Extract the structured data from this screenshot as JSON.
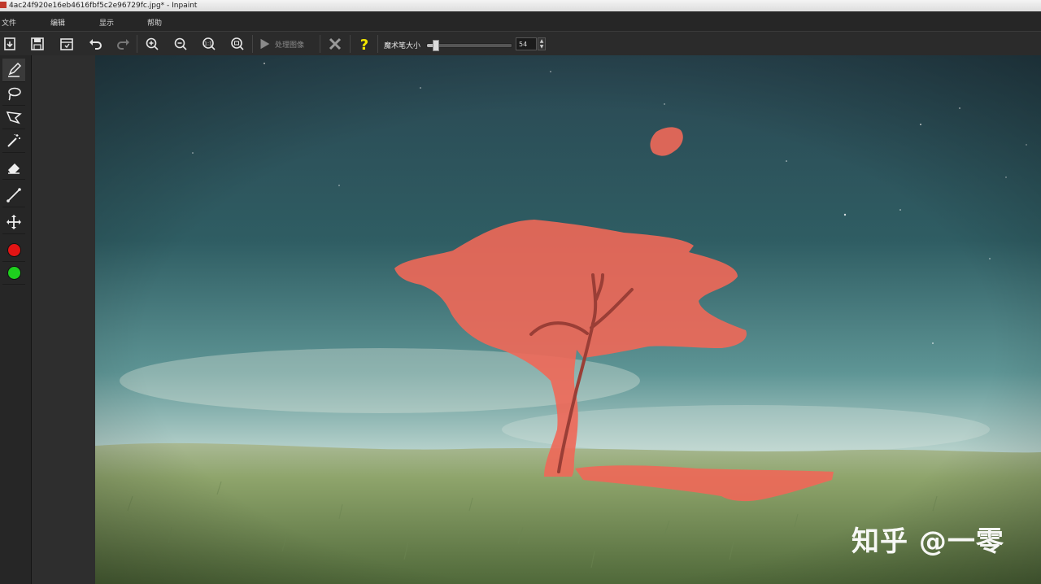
{
  "window": {
    "title": "4ac24f920e16eb4616fbf5c2e96729fc.jpg* - Inpaint"
  },
  "menu": {
    "items": [
      "文件",
      "编辑",
      "显示",
      "帮助"
    ]
  },
  "toolbar": {
    "process_label": "处理图像",
    "brush_size_label": "魔术笔大小",
    "brush_size_value": "54",
    "brush_size_fraction": 0.1
  },
  "tools": [
    "marker-icon",
    "lasso-icon",
    "polygon-lasso-icon",
    "magic-wand-icon",
    "eraser-icon",
    "line-tool-icon",
    "move-icon",
    "red-color-icon",
    "green-color-icon"
  ],
  "colors": {
    "mask": "#f06858",
    "marker_red": "#e31414",
    "marker_green": "#1ecf1e",
    "sky_top": "#2a4a55",
    "grass": "#7e9a5a"
  },
  "watermark": {
    "text": "知乎 @一零"
  }
}
